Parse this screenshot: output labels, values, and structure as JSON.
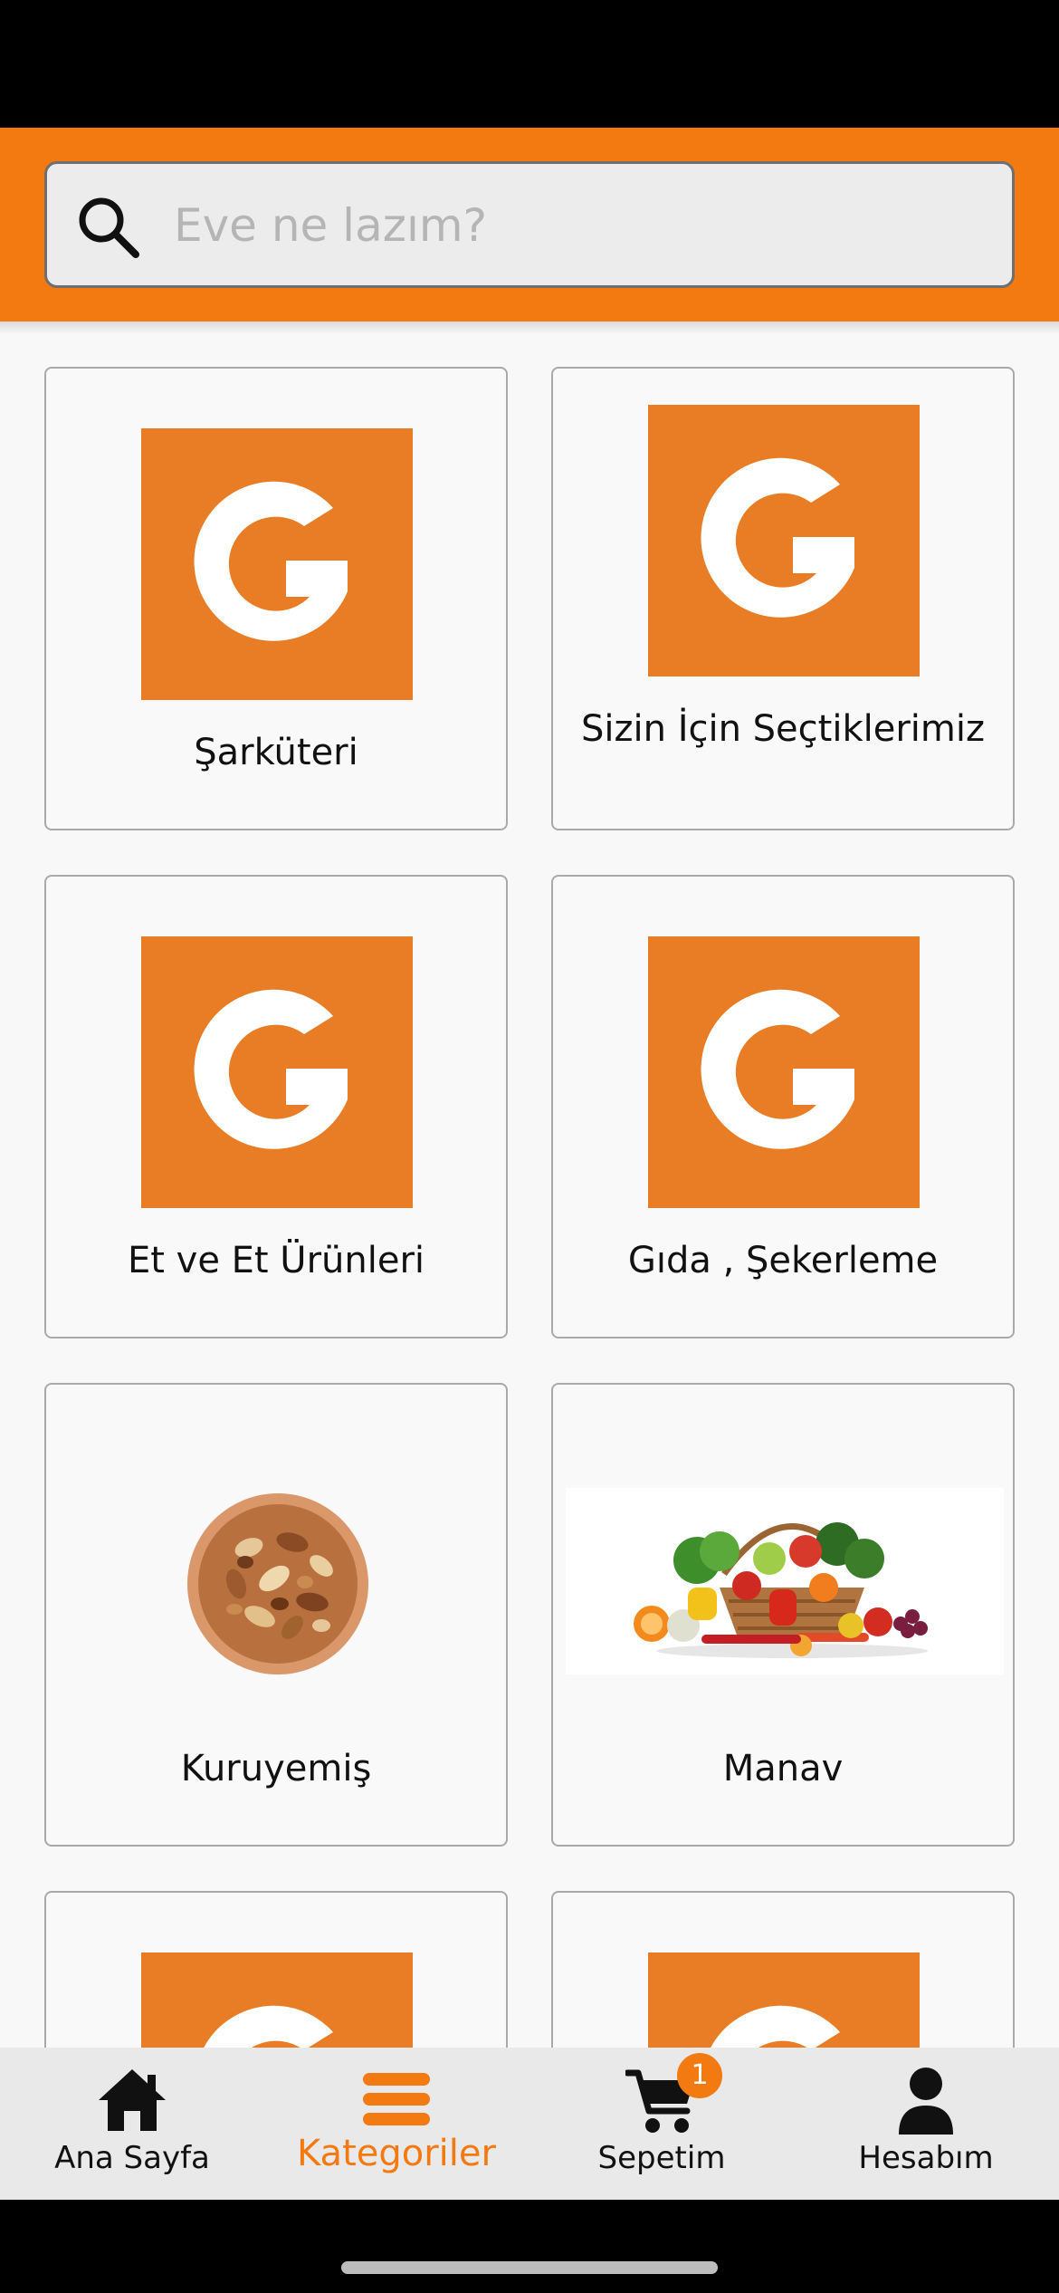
{
  "search": {
    "placeholder": "Eve ne lazım?",
    "value": ""
  },
  "categories": [
    {
      "label": "Şarküteri",
      "image": "g-logo"
    },
    {
      "label": "Sizin İçin Seçtiklerimiz",
      "image": "g-logo"
    },
    {
      "label": "Et ve Et Ürünleri",
      "image": "g-logo"
    },
    {
      "label": "Gıda , Şekerleme",
      "image": "g-logo"
    },
    {
      "label": "Kuruyemiş",
      "image": "nuts-bowl"
    },
    {
      "label": "Manav",
      "image": "vegetable-basket"
    },
    {
      "label": "",
      "image": "g-logo"
    },
    {
      "label": "",
      "image": "g-logo"
    }
  ],
  "nav": {
    "home_label": "Ana Sayfa",
    "categories_label": "Kategoriler",
    "cart_label": "Sepetim",
    "cart_badge": "1",
    "account_label": "Hesabım",
    "active": "categories"
  },
  "colors": {
    "accent": "#f27a10",
    "logo_bg": "#e87d26",
    "nav_bg": "#e9e9e9"
  }
}
